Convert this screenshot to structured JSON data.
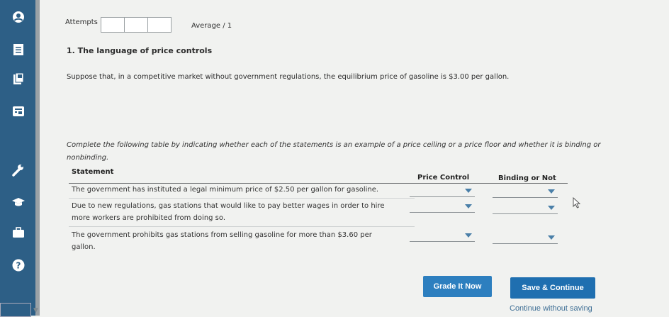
{
  "sidebar": {
    "icons": [
      "user-icon",
      "notes-icon",
      "book-icon",
      "calculator-icon",
      "wrench-icon",
      "graduation-cap-icon",
      "briefcase-icon",
      "help-icon"
    ]
  },
  "header": {
    "attempts_label": "Attempts",
    "average_label": "Average / 1"
  },
  "question": {
    "title": "1. The language of price controls",
    "text": "Suppose that, in a competitive market without government regulations, the equilibrium price of gasoline is $3.00 per gallon.",
    "instructions": "Complete the following table by indicating whether each of the statements is an example of a price ceiling or a price floor and whether it is binding or nonbinding."
  },
  "table": {
    "headers": {
      "statement": "Statement",
      "price_control": "Price Control",
      "binding": "Binding or Not"
    },
    "rows": [
      {
        "statement": "The government has instituted a legal minimum price of $2.50 per gallon for gasoline.",
        "price_control": "",
        "binding": ""
      },
      {
        "statement": "Due to new regulations, gas stations that would like to pay better wages in order to hire more workers are prohibited from doing so.",
        "price_control": "",
        "binding": ""
      },
      {
        "statement": "The government prohibits gas stations from selling gasoline for more than $3.60 per gallon.",
        "price_control": "",
        "binding": ""
      }
    ]
  },
  "actions": {
    "grade_label": "Grade It Now",
    "save_label": "Save & Continue",
    "continue_label": "Continue without saving"
  },
  "colors": {
    "sidebar": "#2d5f86",
    "primary_button": "#2d7fbf",
    "link": "#3f6f95"
  }
}
